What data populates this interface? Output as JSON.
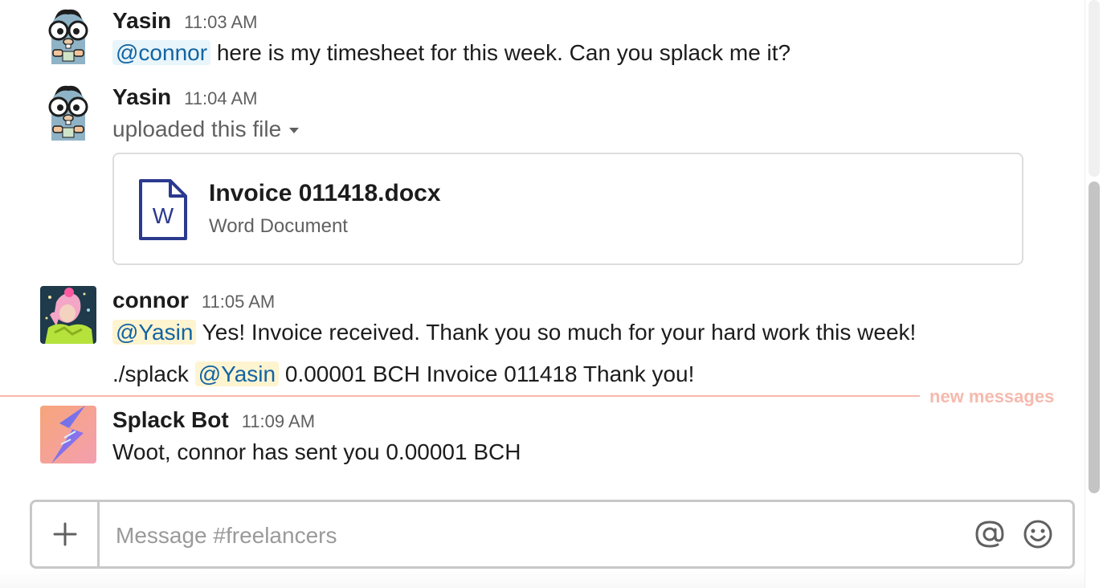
{
  "messages": [
    {
      "author": "Yasin",
      "time": "11:03 AM",
      "mention": "@connor",
      "text": " here is my timesheet for this week. Can you splack me it?",
      "avatar": "gopher-avatar"
    },
    {
      "author": "Yasin",
      "time": "11:04 AM",
      "text": "uploaded this file",
      "avatar": "gopher-avatar",
      "file": {
        "name": "Invoice 011418.docx",
        "type": "Word Document",
        "icon_letter": "W"
      }
    },
    {
      "author": "connor",
      "time": "11:05 AM",
      "avatar": "photo-avatar",
      "line1": {
        "mention": "@Yasin",
        "text": " Yes! Invoice received. Thank you so much for your hard work this week!"
      },
      "line2": {
        "prefix": "./splack ",
        "mention": "@Yasin",
        "text": " 0.00001 BCH Invoice 011418 Thank you!"
      }
    },
    {
      "author": "Splack Bot",
      "time": "11:09 AM",
      "text": "Woot, connor has sent you 0.00001 BCH",
      "avatar": "splack-logo"
    }
  ],
  "divider": {
    "label": "new messages"
  },
  "composer": {
    "placeholder": "Message #freelancers",
    "plus_icon": "plus-icon",
    "at_icon": "at-sign-icon",
    "emoji_icon": "smiley-icon"
  },
  "colors": {
    "mention_text": "#1264a3",
    "mention_bg": "#e8f5fa",
    "mention_self_bg": "#fff4d0",
    "new_messages": "#f6b9ad",
    "file_icon": "#2b3a8f"
  }
}
